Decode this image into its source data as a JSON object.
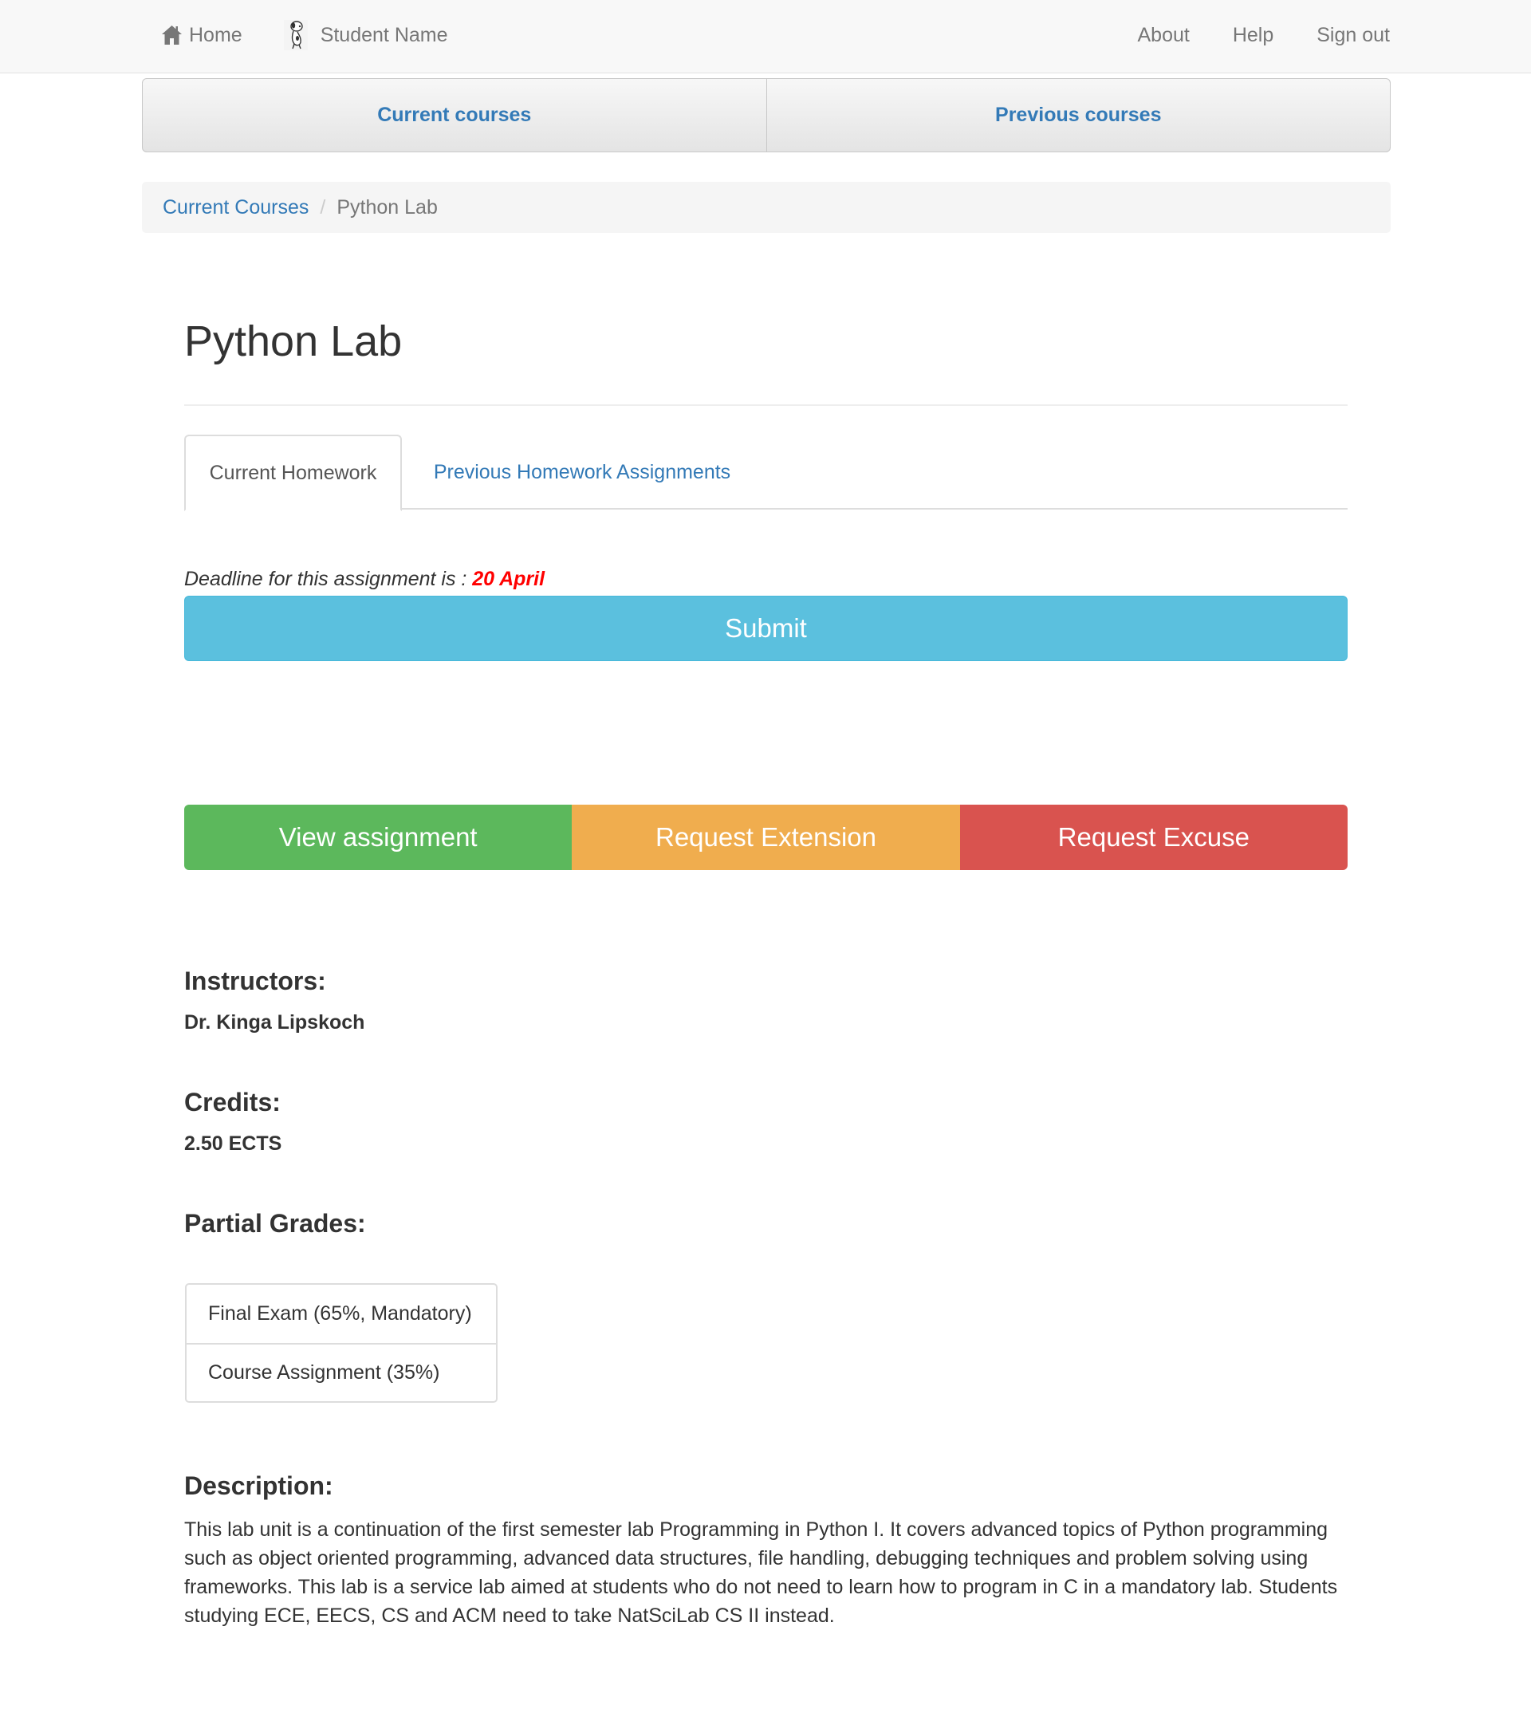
{
  "navbar": {
    "home_label": "Home",
    "student_name": "Student Name",
    "about_label": "About",
    "help_label": "Help",
    "signout_label": "Sign out"
  },
  "course_switch": {
    "current_label": "Current courses",
    "previous_label": "Previous courses"
  },
  "breadcrumb": {
    "items": [
      "Current Courses",
      "Python Lab"
    ],
    "separator": "/"
  },
  "page": {
    "title": "Python Lab"
  },
  "tabs": {
    "current_label": "Current Homework",
    "previous_label": "Previous Homework Assignments",
    "active": "Current Homework"
  },
  "assignment": {
    "deadline_prefix": "Deadline for this assignment is : ",
    "deadline_date": "20 April",
    "submit_label": "Submit"
  },
  "actions": [
    {
      "label": "View assignment",
      "color": "#5cb85c"
    },
    {
      "label": "Request Extension",
      "color": "#f0ad4e"
    },
    {
      "label": "Request Excuse",
      "color": "#d9534f"
    }
  ],
  "instructors": {
    "heading": "Instructors:",
    "value": "Dr. Kinga Lipskoch"
  },
  "credits": {
    "heading": "Credits:",
    "value": "2.50 ECTS"
  },
  "partial_grades": {
    "heading": "Partial Grades:",
    "items": [
      "Final Exam (65%, Mandatory)",
      "Course Assignment (35%)"
    ]
  },
  "description": {
    "heading": "Description:",
    "text": "This lab unit is a continuation of the first semester lab Programming in Python I. It covers advanced topics of Python programming such as object oriented programming, advanced data structures, file handling, debugging techniques and problem solving using frameworks. This lab is a service lab aimed at students who do not need to learn how to program in C in a mandatory lab. Students studying ECE, EECS, CS and ACM need to take NatSciLab CS II instead."
  },
  "colors": {
    "link": "#337ab7",
    "info": "#5bc0de",
    "success": "#5cb85c",
    "warning": "#f0ad4e",
    "danger": "#d9534f",
    "deadline": "#ff0000"
  },
  "icons": [
    "home-icon",
    "avatar-icon"
  ]
}
